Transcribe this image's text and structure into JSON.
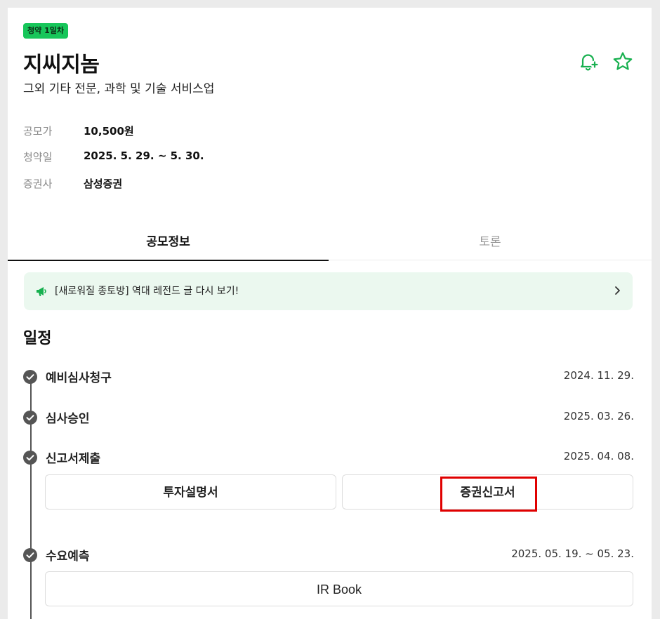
{
  "badge": "청약 1일차",
  "company": {
    "name": "지씨지놈",
    "industry": "그외 기타 전문, 과학 및 기술 서비스업"
  },
  "icons": {
    "alarm": "bell-plus-icon",
    "favorite": "star-icon"
  },
  "info": [
    {
      "label": "공모가",
      "value": "10,500원"
    },
    {
      "label": "청약일",
      "value": "2025. 5. 29. ~ 5. 30."
    },
    {
      "label": "증권사",
      "value": "삼성증권"
    }
  ],
  "tabs": [
    {
      "label": "공모정보",
      "active": true
    },
    {
      "label": "토론",
      "active": false
    }
  ],
  "banner": {
    "text": "[새로워질 종토방] 역대 레전드 글 다시 보기!"
  },
  "schedule": {
    "title": "일정",
    "steps": [
      {
        "name": "예비심사청구",
        "date": "2024. 11. 29."
      },
      {
        "name": "심사승인",
        "date": "2025. 03. 26."
      },
      {
        "name": "신고서제출",
        "date": "2025. 04. 08."
      },
      {
        "name": "수요예측",
        "date": "2025. 05. 19. ~ 05. 23."
      }
    ],
    "filing_buttons": {
      "prospectus": "투자설명서",
      "registration": "증권신고서"
    },
    "ir_button": "IR Book"
  },
  "colors": {
    "accent": "#17c65a",
    "highlight": "#e00000",
    "banner_bg": "#ebf8ef"
  }
}
